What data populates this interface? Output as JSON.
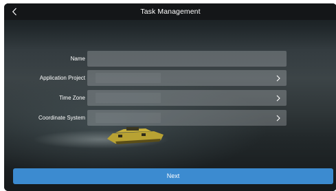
{
  "header": {
    "title": "Task Management",
    "back_icon": "chevron-left-icon"
  },
  "form": {
    "fields": [
      {
        "label": "Name",
        "value": "",
        "type": "text"
      },
      {
        "label": "Application Project",
        "value": "",
        "type": "select",
        "icon": "chevron-right-icon"
      },
      {
        "label": "Time Zone",
        "value": "",
        "type": "select",
        "icon": "chevron-right-icon"
      },
      {
        "label": "Coordinate System",
        "value": "",
        "type": "select",
        "icon": "chevron-right-icon"
      }
    ]
  },
  "footer": {
    "next_label": "Next"
  },
  "colors": {
    "accent": "#3c8bd0",
    "titlebar": "#141618",
    "field_bg": "rgba(205,210,212,0.28)"
  }
}
